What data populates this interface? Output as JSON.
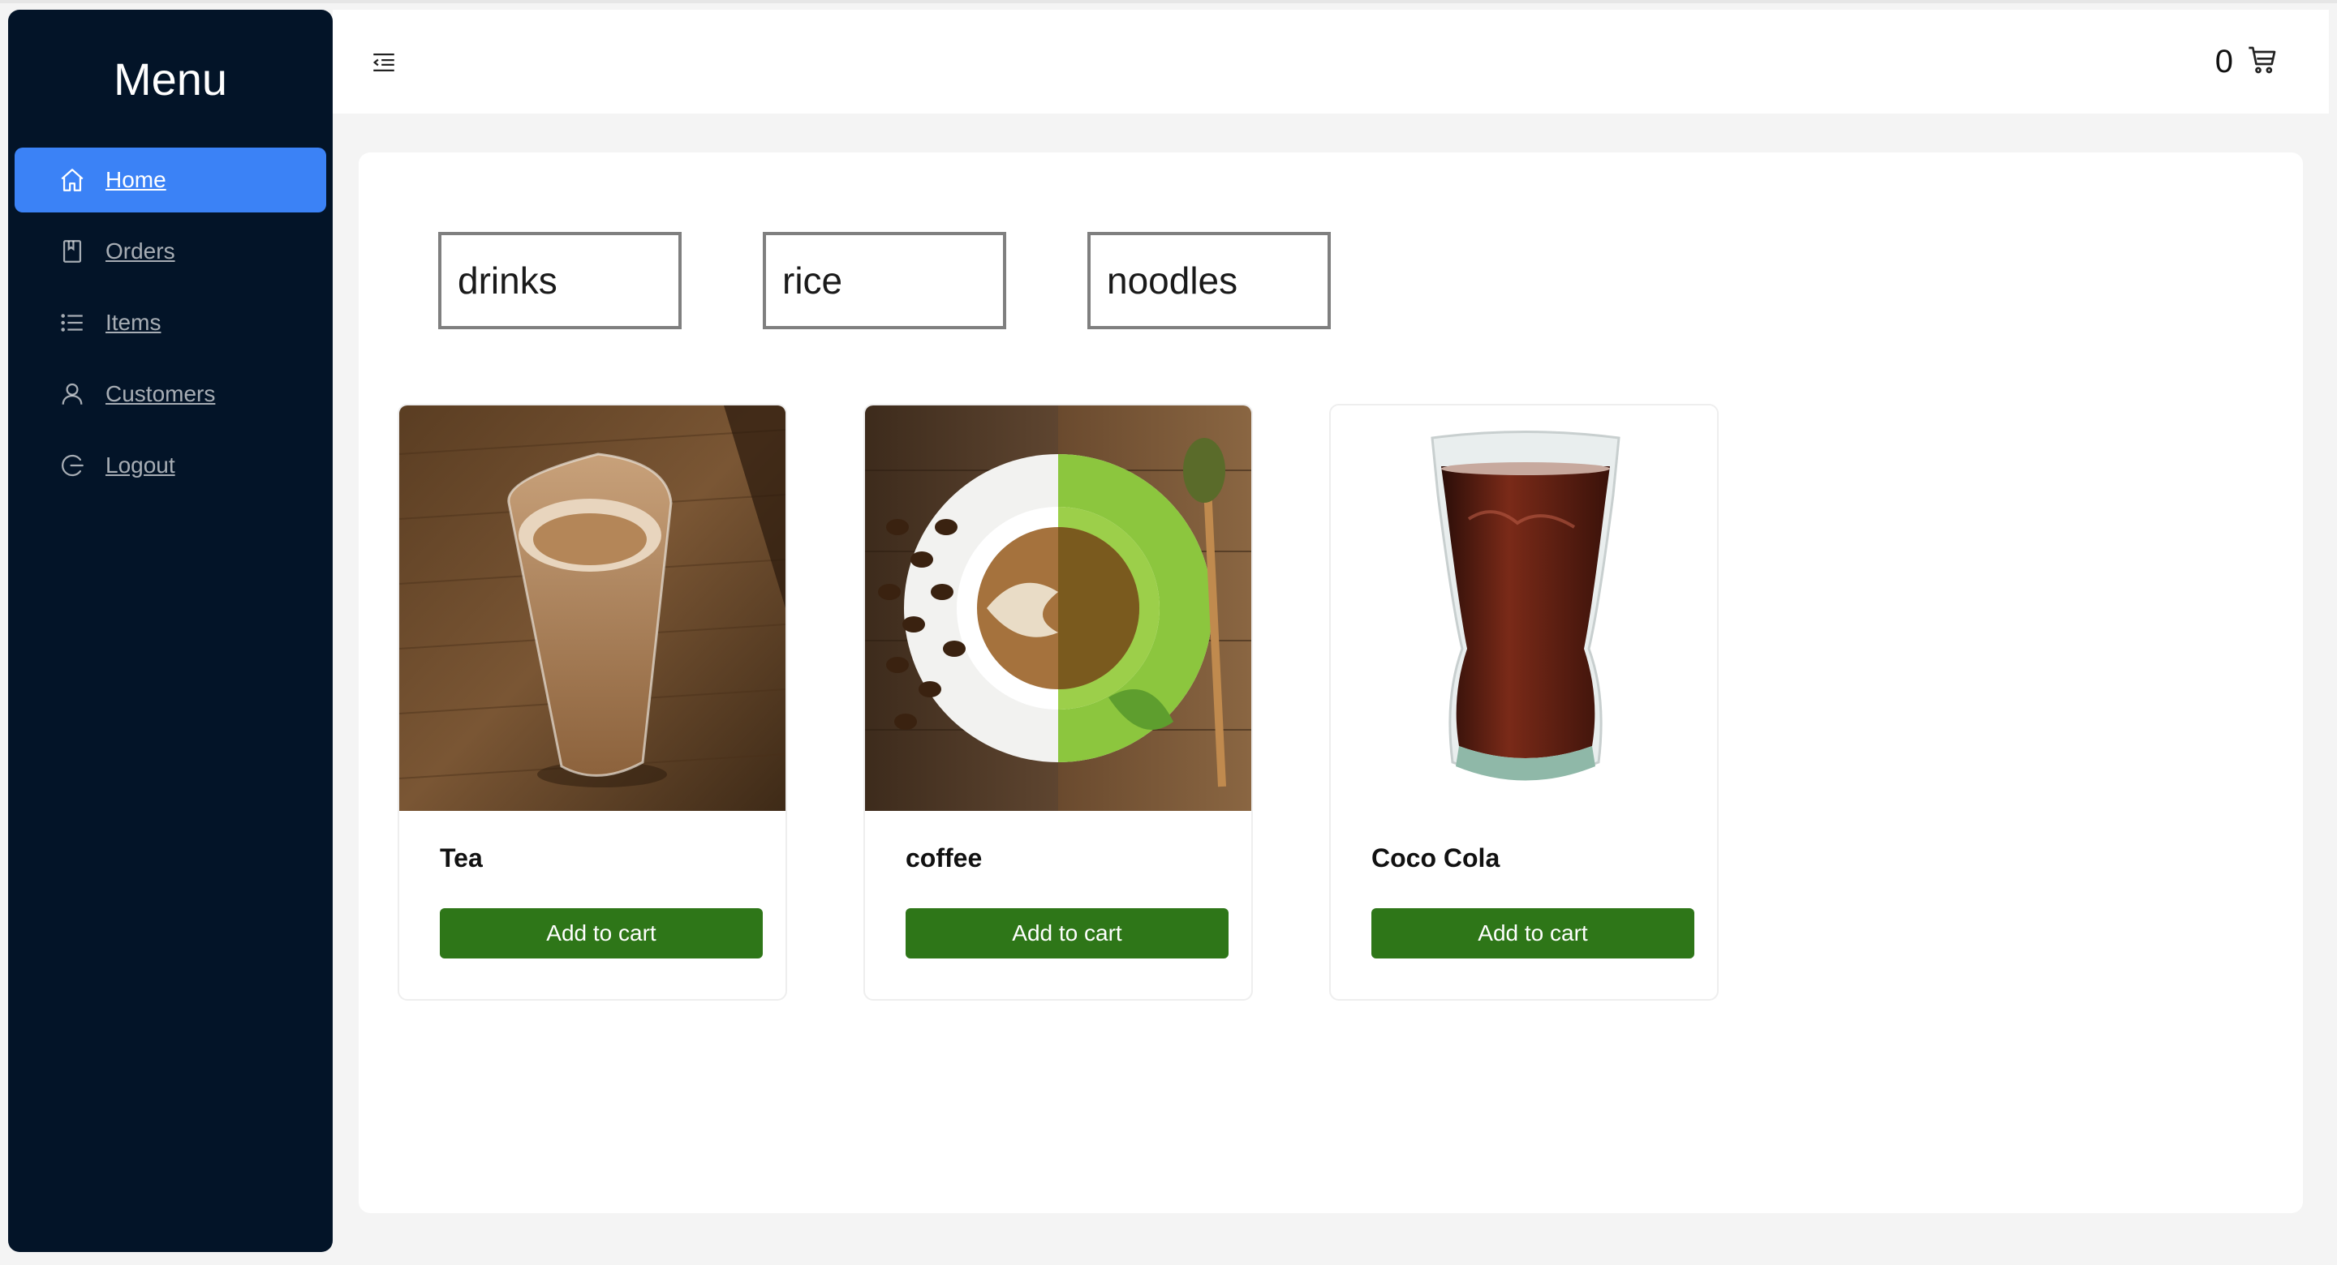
{
  "sidebar": {
    "title": "Menu",
    "items": [
      {
        "label": "Home",
        "icon": "home-icon",
        "active": true
      },
      {
        "label": "Orders",
        "icon": "book-icon",
        "active": false
      },
      {
        "label": "Items",
        "icon": "list-icon",
        "active": false
      },
      {
        "label": "Customers",
        "icon": "user-icon",
        "active": false
      },
      {
        "label": "Logout",
        "icon": "logout-icon",
        "active": false
      }
    ]
  },
  "header": {
    "toggle_icon": "menu-fold-icon",
    "cart_count": "0",
    "cart_icon": "shopping-cart-icon"
  },
  "categories": [
    "drinks",
    "rice",
    "noodles"
  ],
  "products": [
    {
      "name": "Tea",
      "button": "Add to cart"
    },
    {
      "name": "coffee",
      "button": "Add to cart"
    },
    {
      "name": "Coco Cola",
      "button": "Add to cart"
    }
  ],
  "colors": {
    "sidebar_bg": "#031428",
    "active_item": "#3b82f6",
    "add_button": "#2e7618"
  }
}
